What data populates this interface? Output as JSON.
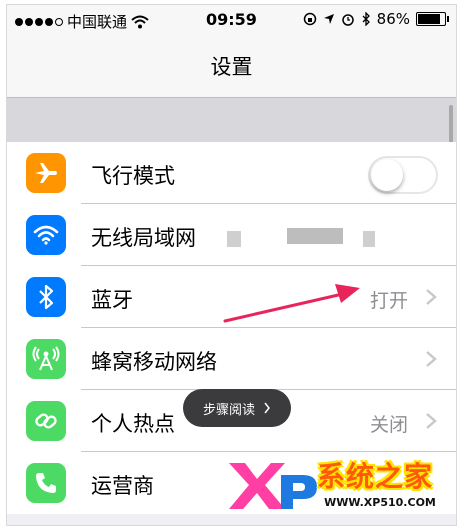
{
  "status_bar": {
    "carrier": "中国联通",
    "time": "09:59",
    "battery": "86%",
    "battery_level": 0.86
  },
  "nav": {
    "title": "设置"
  },
  "settings": [
    {
      "label": "飞行模式",
      "icon": "airplane-icon",
      "color": "#ff9500",
      "control": "toggle",
      "toggle_on": false
    },
    {
      "label": "无线局域网",
      "icon": "wifi-icon",
      "color": "#007aff",
      "control": "blurred-value"
    },
    {
      "label": "蓝牙",
      "icon": "bluetooth-icon",
      "color": "#007aff",
      "value": "打开",
      "control": "chevron"
    },
    {
      "label": "蜂窝移动网络",
      "icon": "cellular-icon",
      "color": "#4cd964",
      "control": "chevron"
    },
    {
      "label": "个人热点",
      "icon": "hotspot-icon",
      "color": "#4cd964",
      "value": "关闭",
      "control": "chevron"
    },
    {
      "label": "运营商",
      "icon": "phone-icon",
      "color": "#4cd964",
      "control": "none"
    }
  ],
  "toast": {
    "text": "步骤阅读"
  },
  "annotation": {
    "arrow_color": "#e8245a"
  },
  "watermark": {
    "name": "系统之家",
    "url": "WWW.XP510.COM"
  }
}
